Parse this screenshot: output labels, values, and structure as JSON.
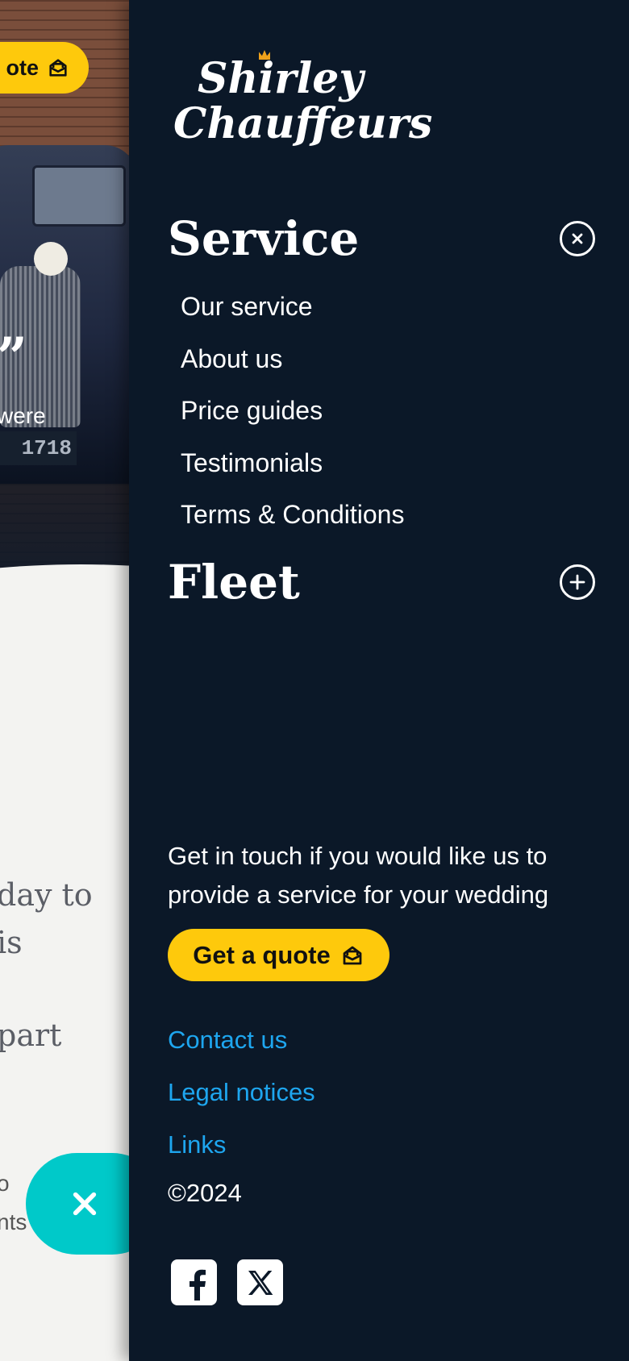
{
  "background_page": {
    "quote_pill_label": "ote",
    "hero_quote_mark": "”",
    "hero_text": "were",
    "plate": "1718",
    "body_lines": [
      "day to",
      " is",
      "part"
    ],
    "small_lines": [
      "o",
      "nts"
    ]
  },
  "menu": {
    "logo_line1": "Shirley",
    "logo_line2": "Chauffeurs",
    "service": {
      "title": "Service",
      "expanded": true,
      "items": [
        "Our service",
        "About us",
        "Price guides",
        "Testimonials",
        "Terms & Conditions"
      ]
    },
    "fleet": {
      "title": "Fleet",
      "expanded": false
    },
    "touch_text": "Get in touch if you would like us to provide a service for your wedding",
    "quote_button": "Get a quote",
    "footer_links": [
      "Contact us",
      "Legal notices",
      "Links"
    ],
    "copyright": "©2024",
    "social": [
      "facebook-icon",
      "x-icon"
    ]
  },
  "colors": {
    "panel_bg": "#0b1828",
    "accent_yellow": "#fec90c",
    "link_blue": "#1ea6ef",
    "fab_teal": "#00c9c9"
  }
}
